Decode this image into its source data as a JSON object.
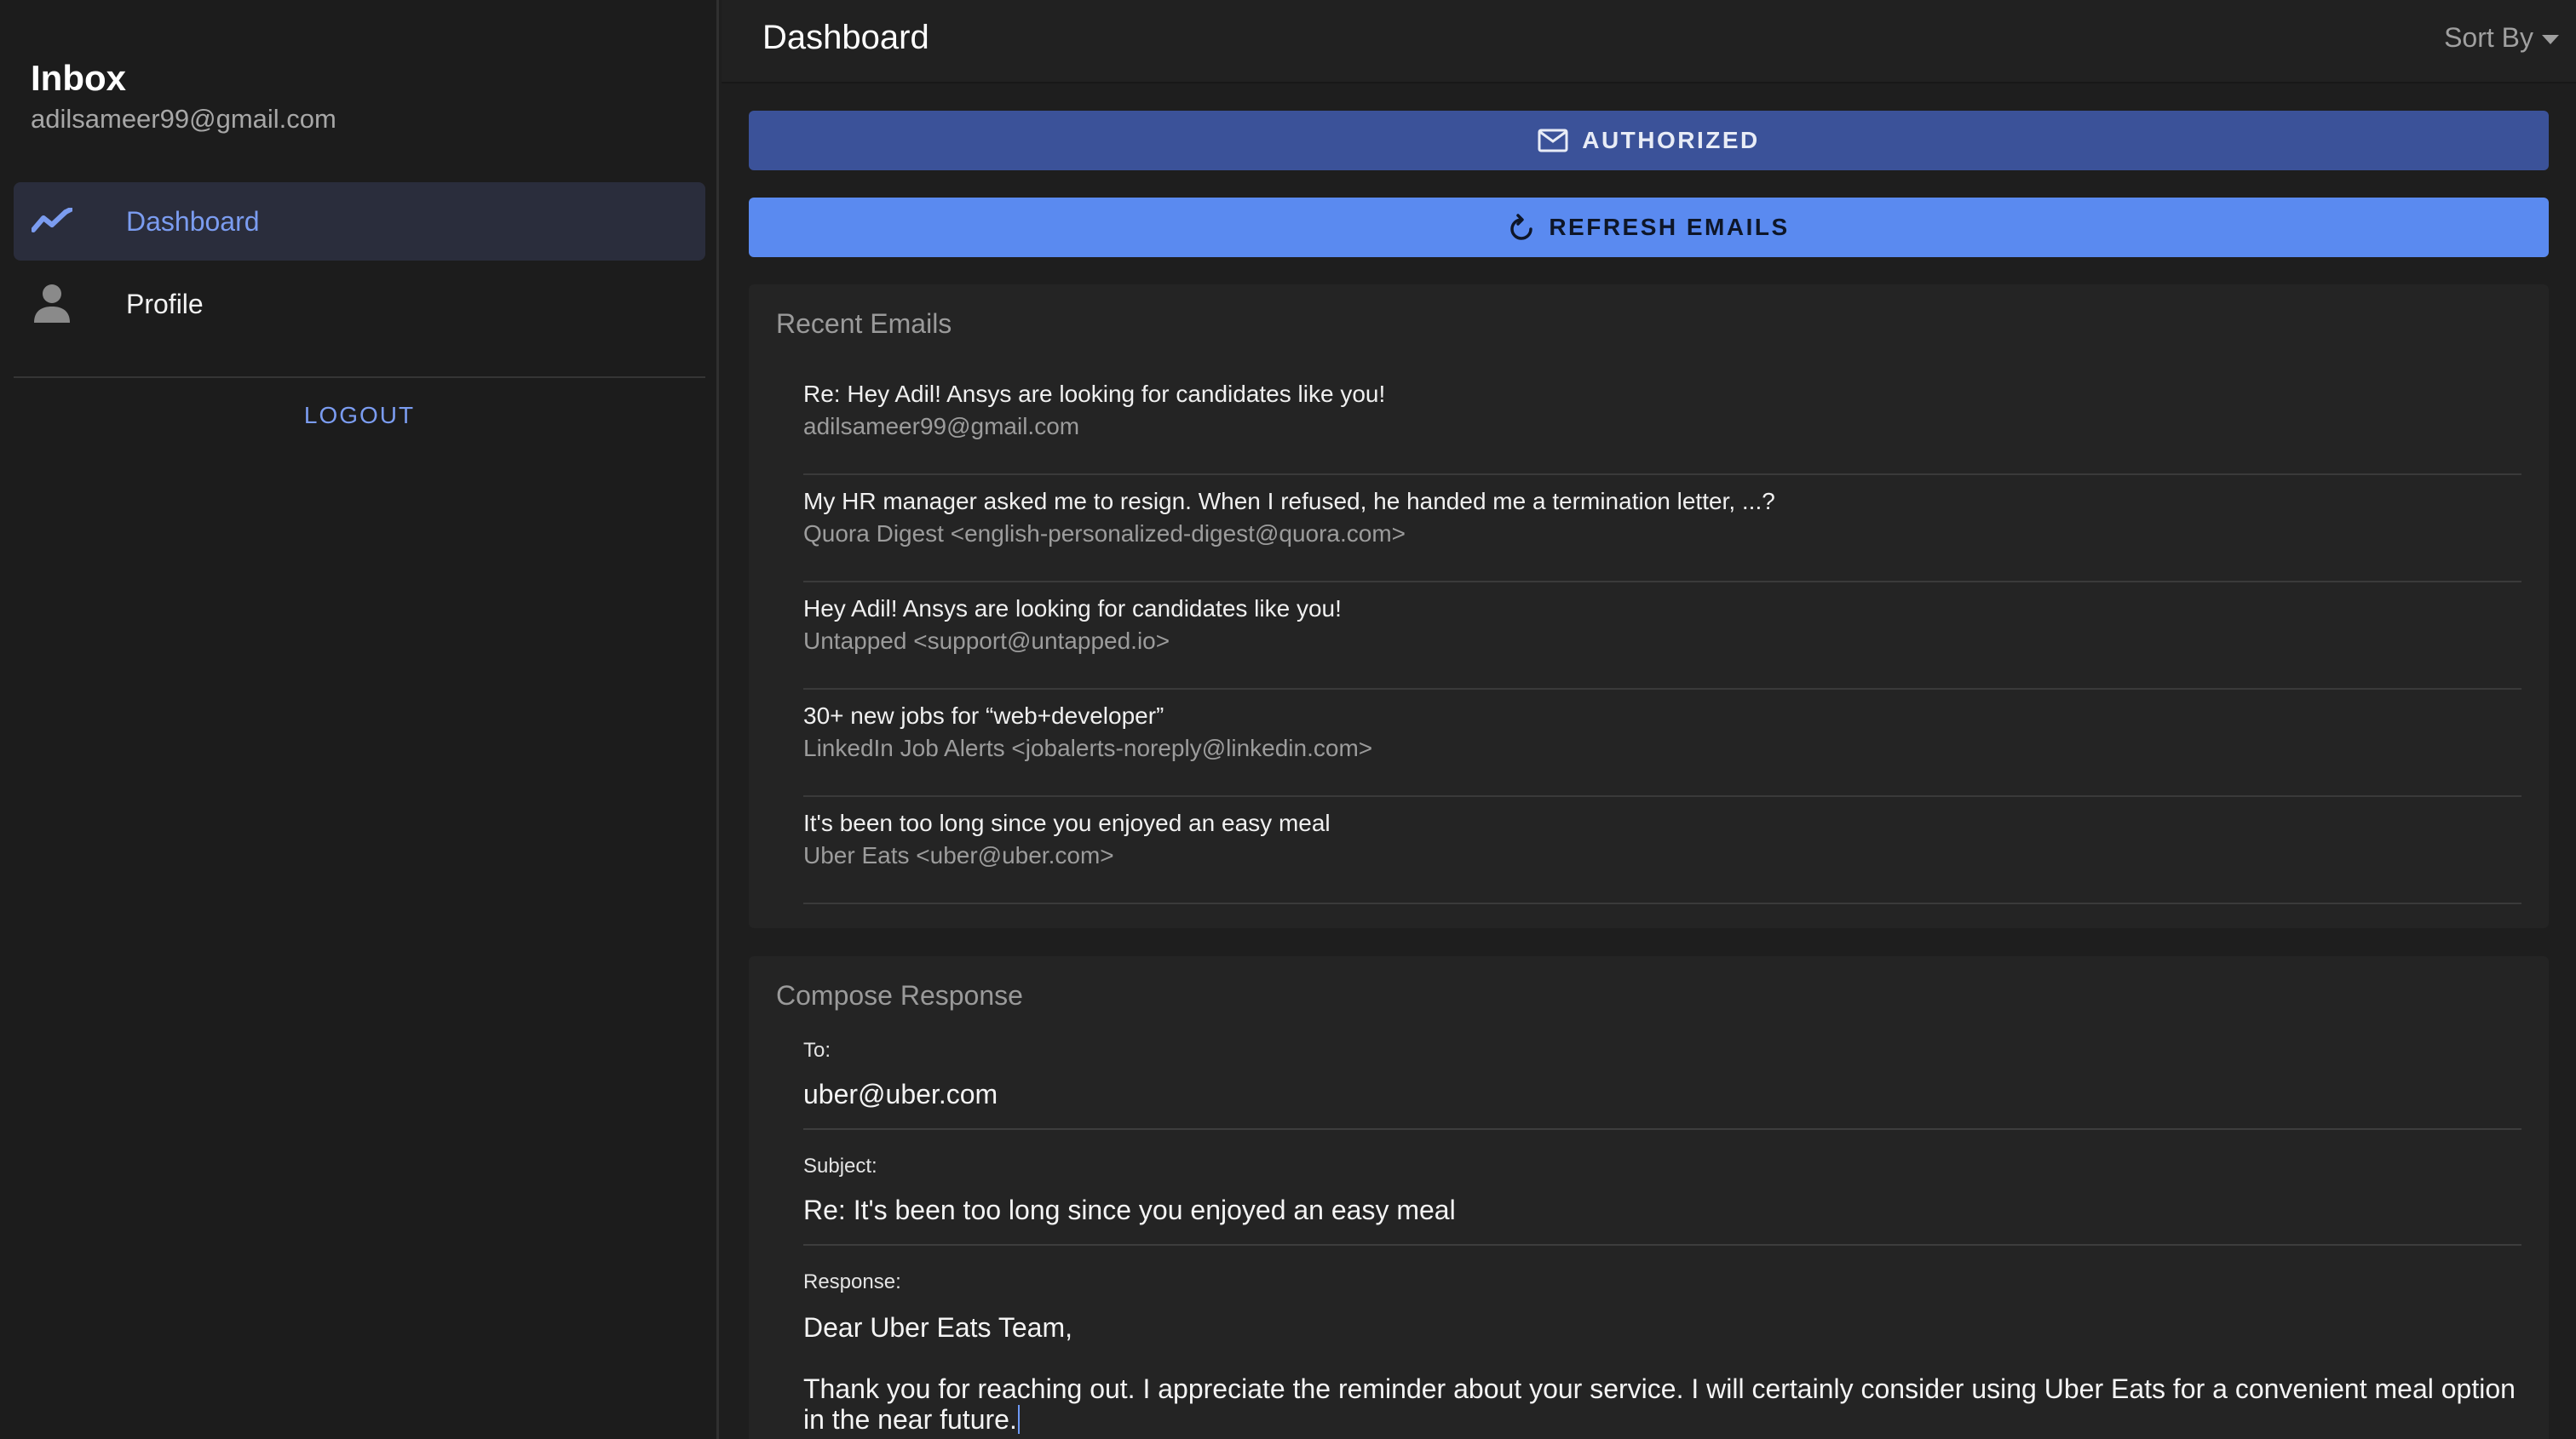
{
  "sidebar": {
    "title": "Inbox",
    "email": "adilsameer99@gmail.com",
    "nav": [
      {
        "label": "Dashboard",
        "icon": "trending-up-icon",
        "active": true
      },
      {
        "label": "Profile",
        "icon": "person-icon",
        "active": false
      }
    ],
    "logout_label": "LOGOUT"
  },
  "header": {
    "title": "Dashboard",
    "sort_label": "Sort By"
  },
  "buttons": {
    "authorized_label": "AUTHORIZED",
    "refresh_label": "REFRESH EMAILS"
  },
  "recent": {
    "title": "Recent Emails",
    "emails": [
      {
        "subject": "Re: Hey Adil! Ansys are looking for candidates like you!",
        "from": "adilsameer99@gmail.com"
      },
      {
        "subject": "My HR manager asked me to resign. When I refused, he handed me a termination letter, ...?",
        "from": "Quora Digest <english-personalized-digest@quora.com>"
      },
      {
        "subject": "Hey Adil! Ansys are looking for candidates like you!",
        "from": "Untapped <support@untapped.io>"
      },
      {
        "subject": "30+ new jobs for “web+developer”",
        "from": "LinkedIn Job Alerts <jobalerts-noreply@linkedin.com>"
      },
      {
        "subject": "It's been too long since you enjoyed an easy meal",
        "from": "Uber Eats <uber@uber.com>"
      }
    ]
  },
  "compose": {
    "title": "Compose Response",
    "to_label": "To:",
    "to_value": "uber@uber.com",
    "subject_label": "Subject:",
    "subject_value": "Re: It's been too long since you enjoyed an easy meal",
    "response_label": "Response:",
    "response_greeting": "Dear Uber Eats Team,",
    "response_body": "Thank you for reaching out. I appreciate the reminder about your service. I will certainly consider using Uber Eats for a convenient meal option in the near future."
  },
  "colors": {
    "accent": "#7b9cf0",
    "authorized_button": "#3b5299",
    "refresh_button": "#5a8af0",
    "background": "#1e1e1e",
    "card": "#242424"
  }
}
